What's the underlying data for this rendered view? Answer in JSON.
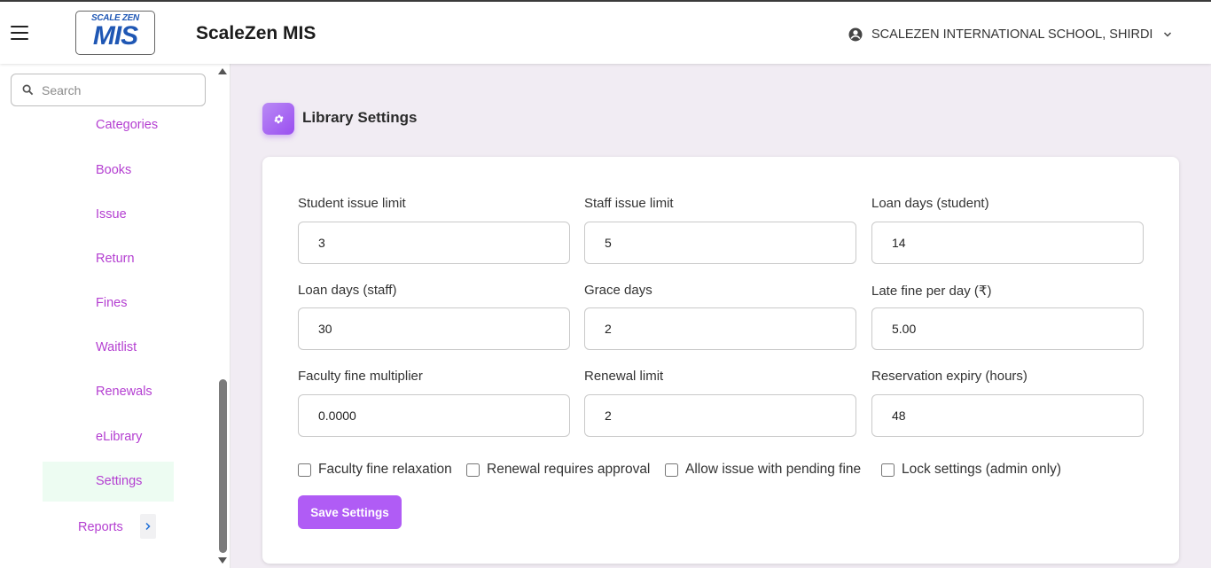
{
  "header": {
    "logo_top": "SCALE ZEN",
    "logo_main": "MIS",
    "app_title": "ScaleZen MIS",
    "school": "SCALEZEN INTERNATIONAL SCHOOL, SHIRDI"
  },
  "sidebar": {
    "search_placeholder": "Search",
    "items": [
      "Categories",
      "Books",
      "Issue",
      "Return",
      "Fines",
      "Waitlist",
      "Renewals",
      "eLibrary"
    ],
    "active": "Settings",
    "reports": "Reports"
  },
  "page": {
    "title": "Library Settings"
  },
  "form": {
    "fields": [
      {
        "label": "Student issue limit",
        "value": "3"
      },
      {
        "label": "Staff issue limit",
        "value": "5"
      },
      {
        "label": "Loan days (student)",
        "value": "14"
      },
      {
        "label": "Loan days (staff)",
        "value": "30"
      },
      {
        "label": "Grace days",
        "value": "2"
      },
      {
        "label": "Late fine per day (₹)",
        "value": "5.00"
      },
      {
        "label": "Faculty fine multiplier",
        "value": "0.0000"
      },
      {
        "label": "Renewal limit",
        "value": "2"
      },
      {
        "label": "Reservation expiry (hours)",
        "value": "48"
      }
    ],
    "checkboxes": [
      {
        "label": "Faculty fine relaxation",
        "checked": false
      },
      {
        "label": "Renewal requires approval",
        "checked": false
      },
      {
        "label": "Allow issue with pending fine",
        "checked": false
      },
      {
        "label": "Lock settings (admin only)",
        "checked": false
      }
    ],
    "save_label": "Save Settings"
  },
  "colors": {
    "accent": "#b05cf5",
    "nav_text": "#b43fd1",
    "active_bg": "#edfcf2"
  }
}
